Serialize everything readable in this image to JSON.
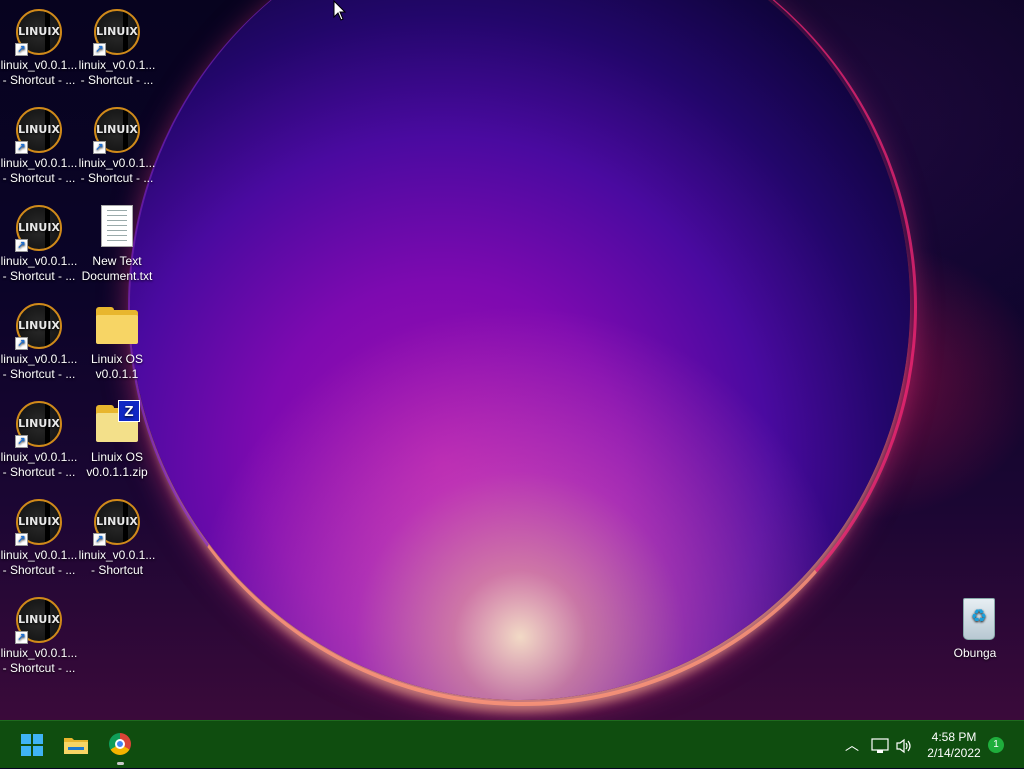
{
  "desktop": {
    "icons": [
      {
        "kind": "linuix",
        "label": "linuix_v0.0.1...\n- Shortcut - ..."
      },
      {
        "kind": "linuix",
        "label": "linuix_v0.0.1...\n- Shortcut - ..."
      },
      {
        "kind": "linuix",
        "label": "linuix_v0.0.1...\n- Shortcut - ..."
      },
      {
        "kind": "linuix",
        "label": "linuix_v0.0.1...\n- Shortcut - ..."
      },
      {
        "kind": "linuix",
        "label": "linuix_v0.0.1...\n- Shortcut - ..."
      },
      {
        "kind": "text",
        "label": "New Text\nDocument.txt"
      },
      {
        "kind": "linuix",
        "label": "linuix_v0.0.1...\n- Shortcut - ..."
      },
      {
        "kind": "folder",
        "label": "Linuix OS\nv0.0.1.1"
      },
      {
        "kind": "linuix",
        "label": "linuix_v0.0.1...\n- Shortcut - ..."
      },
      {
        "kind": "zip",
        "label": "Linuix OS\nv0.0.1.1.zip"
      },
      {
        "kind": "linuix",
        "label": "linuix_v0.0.1...\n- Shortcut - ..."
      },
      {
        "kind": "linuix",
        "label": "linuix_v0.0.1...\n- Shortcut"
      },
      {
        "kind": "linuix",
        "label": "linuix_v0.0.1...\n- Shortcut - ..."
      }
    ],
    "logo_text": "LINUIX",
    "zip_badge": "Z",
    "recycle_bin": {
      "label": "Obunga",
      "icon": "recycle-bin-icon"
    }
  },
  "taskbar": {
    "start": {
      "icon": "windows-start-icon"
    },
    "pinned": [
      {
        "name": "File Explorer",
        "icon": "folder-icon"
      },
      {
        "name": "Google Chrome",
        "icon": "chrome-icon",
        "running": true
      }
    ],
    "tray": {
      "overflow_icon": "chevron-up-icon",
      "network_icon": "network-icon",
      "volume_icon": "volume-icon",
      "time": "4:58 PM",
      "date": "2/14/2022",
      "notification_count": "1"
    }
  },
  "colors": {
    "taskbar_bg": "#0f4d0f",
    "accent": "#3fb3f5",
    "notification": "#1fae3c"
  }
}
